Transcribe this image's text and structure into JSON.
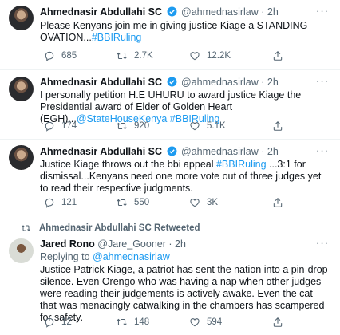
{
  "tweets": [
    {
      "name": "Ahmednasir Abdullahi SC",
      "handle": "@ahmednasirlaw",
      "time": "2h",
      "text_plain": "Please Kenyans join me in giving justice Kiage a STANDING OVATION...",
      "hashtags": [
        "#BBIRuling"
      ],
      "replies": "685",
      "retweets": "2.7K",
      "likes": "12.2K"
    },
    {
      "name": "Ahmednasir Abdullahi SC",
      "handle": "@ahmednasirlaw",
      "time": "2h",
      "text_plain": "I personally petition H.E UHURU to award justice Kiage the Presidential award of Elder of Golden Heart (EGH)...",
      "mention": "@StateHouseKenya",
      "hashtag": "#BBIRuling",
      "replies": "174",
      "retweets": "920",
      "likes": "5.1K"
    },
    {
      "name": "Ahmednasir Abdullahi SC",
      "handle": "@ahmednasirlaw",
      "time": "2h",
      "text_before": "Justice Kiage throws out the bbi appeal ",
      "hashtag": "#BBIRuling",
      "text_after": " ...3:1 for dismissal...Kenyans need one more vote out of three judges yet to read their respective judgments.",
      "replies": "121",
      "retweets": "550",
      "likes": "3K"
    },
    {
      "retweeted_by": "Ahmednasir Abdullahi SC Retweeted",
      "name": "Jared Rono",
      "handle": "@Jare_Gooner",
      "time": "2h",
      "replying_prefix": "Replying to",
      "replying_to": "@ahmednasirlaw",
      "text_plain": "Justice Patrick Kiage, a patriot has sent the nation into a pin-drop silence. Even Orengo who was having a nap when other judges were reading their judgements is actively awake.  Even the cat that was menacingly catwalking in the chambers has scampered for safety.",
      "replies": "12",
      "retweets": "148",
      "likes": "594"
    }
  ],
  "ui": {
    "separator": "·",
    "more": "···"
  },
  "icons": {
    "reply": "reply-icon",
    "retweet": "retweet-icon",
    "like": "heart-icon",
    "share": "share-icon",
    "verified": "verified-badge-icon",
    "more": "more-options-icon"
  },
  "colors": {
    "link": "#1d9bf0",
    "muted": "#536471",
    "verified": "#1d9bf0",
    "divider": "#eff3f4"
  }
}
